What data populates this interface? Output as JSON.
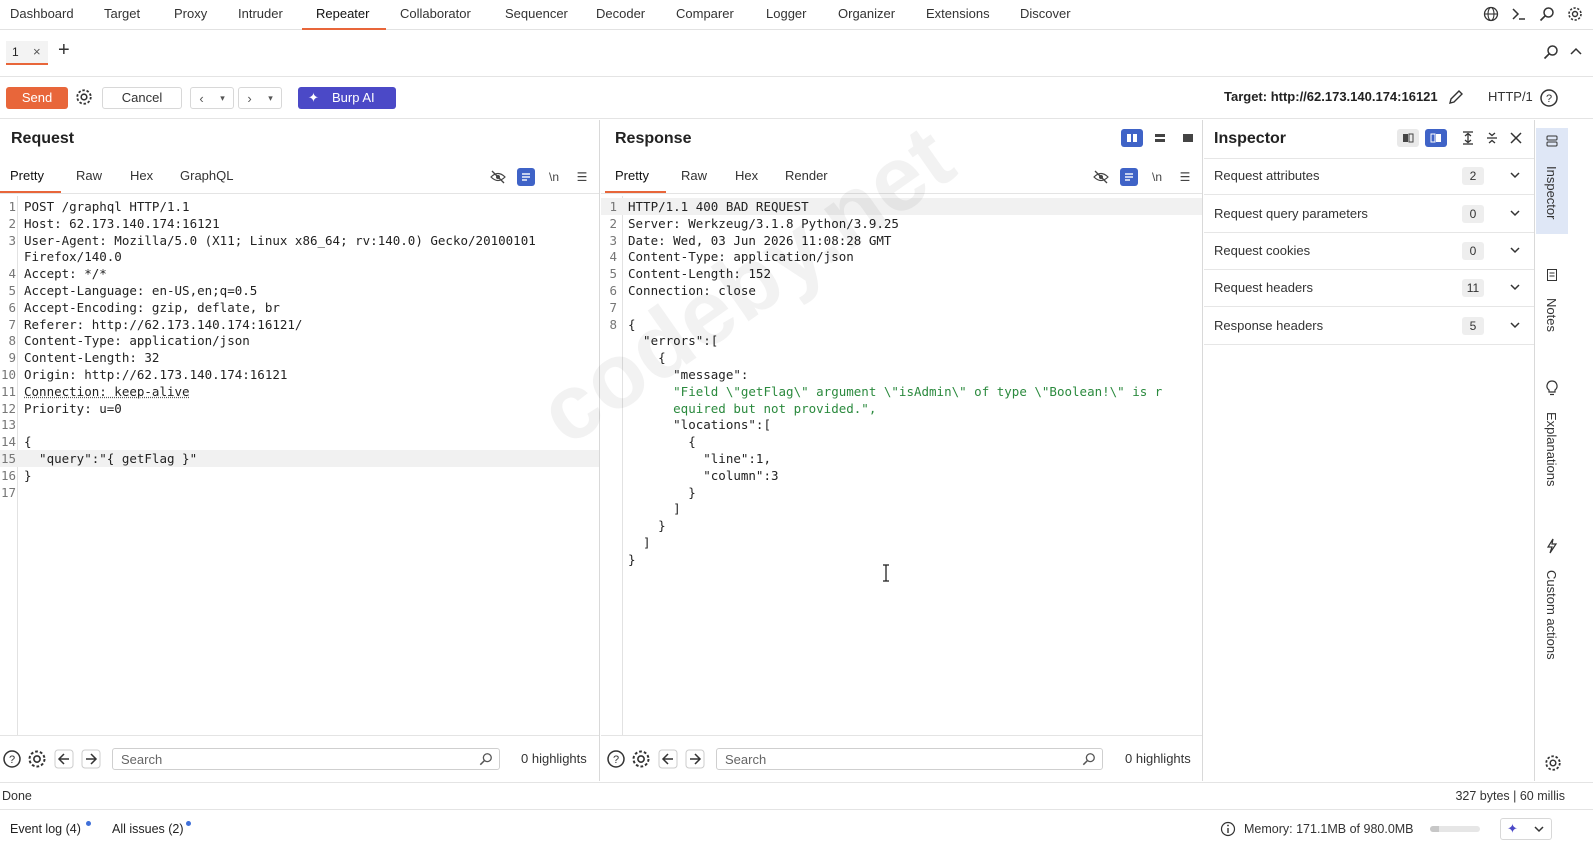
{
  "topnav": {
    "items": [
      "Dashboard",
      "Target",
      "Proxy",
      "Intruder",
      "Repeater",
      "Collaborator",
      "Sequencer",
      "Decoder",
      "Comparer",
      "Logger",
      "Organizer",
      "Extensions",
      "Discover"
    ],
    "active": "Repeater",
    "icons": [
      "globe-icon",
      "terminal-icon",
      "search-icon",
      "gear-icon"
    ]
  },
  "tabs": {
    "items": [
      {
        "label": "1"
      }
    ],
    "close": "×",
    "add": "+"
  },
  "toolbar": {
    "send": "Send",
    "cancel": "Cancel",
    "burp_ai": "Burp AI",
    "target": "Target: http://62.173.140.174:16121",
    "http_version": "HTTP/1"
  },
  "request": {
    "title": "Request",
    "tabs": [
      "Pretty",
      "Raw",
      "Hex",
      "GraphQL"
    ],
    "active_tab": "Pretty",
    "search_placeholder": "Search",
    "highlights": "0 highlights",
    "lines": [
      {
        "n": "1",
        "text": "POST /graphql HTTP/1.1"
      },
      {
        "n": "2",
        "text": "Host: 62.173.140.174:16121"
      },
      {
        "n": "3",
        "text": "User-Agent: Mozilla/5.0 (X11; Linux x86_64; rv:140.0) Gecko/20100101"
      },
      {
        "n": "",
        "text": "Firefox/140.0"
      },
      {
        "n": "4",
        "text": "Accept: */*"
      },
      {
        "n": "5",
        "text": "Accept-Language: en-US,en;q=0.5"
      },
      {
        "n": "6",
        "text": "Accept-Encoding: gzip, deflate, br"
      },
      {
        "n": "7",
        "text": "Referer: http://62.173.140.174:16121/"
      },
      {
        "n": "8",
        "text": "Content-Type: application/json"
      },
      {
        "n": "9",
        "text": "Content-Length: 32"
      },
      {
        "n": "10",
        "text": "Origin: http://62.173.140.174:16121"
      },
      {
        "n": "11",
        "text": "Connection: keep-alive"
      },
      {
        "n": "12",
        "text": "Priority: u=0"
      },
      {
        "n": "13",
        "text": ""
      },
      {
        "n": "14",
        "text": "{"
      },
      {
        "n": "15",
        "text": "  \"query\":\"{ getFlag }\""
      },
      {
        "n": "16",
        "text": "}"
      },
      {
        "n": "17",
        "text": ""
      }
    ]
  },
  "response": {
    "title": "Response",
    "tabs": [
      "Pretty",
      "Raw",
      "Hex",
      "Render"
    ],
    "active_tab": "Pretty",
    "search_placeholder": "Search",
    "highlights": "0 highlights",
    "lines": [
      {
        "n": "1",
        "text": "HTTP/1.1 400 BAD REQUEST"
      },
      {
        "n": "2",
        "text": "Server: Werkzeug/3.1.8 Python/3.9.25"
      },
      {
        "n": "3",
        "text": "Date: Wed, 03 Jun 2026 11:08:28 GMT"
      },
      {
        "n": "4",
        "text": "Content-Type: application/json"
      },
      {
        "n": "5",
        "text": "Content-Length: 152"
      },
      {
        "n": "6",
        "text": "Connection: close"
      },
      {
        "n": "7",
        "text": ""
      },
      {
        "n": "8",
        "text": "{"
      },
      {
        "n": "",
        "text": "  \"errors\":["
      },
      {
        "n": "",
        "text": "    {"
      },
      {
        "n": "",
        "text": "      \"message\":"
      },
      {
        "n": "",
        "text": "      \"Field \\\"getFlag\\\" argument \\\"isAdmin\\\" of type \\\"Boolean!\\\" is r"
      },
      {
        "n": "",
        "text": "      equired but not provided.\","
      },
      {
        "n": "",
        "text": "      \"locations\":["
      },
      {
        "n": "",
        "text": "        {"
      },
      {
        "n": "",
        "text": "          \"line\":1,"
      },
      {
        "n": "",
        "text": "          \"column\":3"
      },
      {
        "n": "",
        "text": "        }"
      },
      {
        "n": "",
        "text": "      ]"
      },
      {
        "n": "",
        "text": "    }"
      },
      {
        "n": "",
        "text": "  ]"
      },
      {
        "n": "",
        "text": "}"
      }
    ]
  },
  "inspector": {
    "title": "Inspector",
    "rows": [
      {
        "label": "Request attributes",
        "count": "2"
      },
      {
        "label": "Request query parameters",
        "count": "0"
      },
      {
        "label": "Request cookies",
        "count": "0"
      },
      {
        "label": "Request headers",
        "count": "11"
      },
      {
        "label": "Response headers",
        "count": "5"
      }
    ]
  },
  "side_strip": [
    "Inspector",
    "Notes",
    "Explanations",
    "Custom actions"
  ],
  "watermark": "codeby.net",
  "status": {
    "left": "Done",
    "right": "327 bytes | 60 millis"
  },
  "bottom": {
    "event_log": "Event log (4)",
    "all_issues": "All issues (2)",
    "memory": "Memory: 171.1MB of 980.0MB",
    "memory_fraction": 0.17
  },
  "colors": {
    "accent": "#e8663a",
    "burp_ai": "#4b49c7",
    "toggle": "#3f63c7",
    "string": "#2b8a3e"
  }
}
